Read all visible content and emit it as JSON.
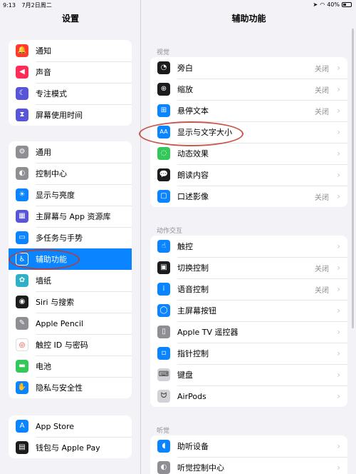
{
  "status": {
    "time": "9:13",
    "date": "7月2日周二",
    "battery": "40%"
  },
  "sidebar": {
    "title": "设置",
    "groups": [
      [
        {
          "label": "通知",
          "icon": "bell-icon"
        },
        {
          "label": "声音",
          "icon": "speaker-icon"
        },
        {
          "label": "专注模式",
          "icon": "moon-icon"
        },
        {
          "label": "屏幕使用时间",
          "icon": "hourglass-icon"
        }
      ],
      [
        {
          "label": "通用",
          "icon": "gear-icon"
        },
        {
          "label": "控制中心",
          "icon": "toggles-icon"
        },
        {
          "label": "显示与亮度",
          "icon": "sun-icon"
        },
        {
          "label": "主屏幕与 App 资源库",
          "icon": "grid-icon"
        },
        {
          "label": "多任务与手势",
          "icon": "multitask-icon"
        },
        {
          "label": "辅助功能",
          "icon": "accessibility-icon",
          "selected": true
        },
        {
          "label": "墙纸",
          "icon": "flower-icon"
        },
        {
          "label": "Siri 与搜索",
          "icon": "siri-icon"
        },
        {
          "label": "Apple Pencil",
          "icon": "pencil-icon"
        },
        {
          "label": "触控 ID 与密码",
          "icon": "fingerprint-icon"
        },
        {
          "label": "电池",
          "icon": "battery-icon"
        },
        {
          "label": "隐私与安全性",
          "icon": "hand-icon"
        }
      ],
      [
        {
          "label": "App Store",
          "icon": "appstore-icon"
        },
        {
          "label": "钱包与 Apple Pay",
          "icon": "wallet-icon"
        }
      ]
    ]
  },
  "detail": {
    "title": "辅助功能",
    "sections": [
      {
        "header": "视觉",
        "rows": [
          {
            "label": "旁白",
            "value": "关闭",
            "icon": "voiceover-icon"
          },
          {
            "label": "缩放",
            "value": "关闭",
            "icon": "zoom-icon"
          },
          {
            "label": "悬停文本",
            "value": "关闭",
            "icon": "hover-text-icon"
          },
          {
            "label": "显示与文字大小",
            "value": "",
            "icon": "text-size-icon"
          },
          {
            "label": "动态效果",
            "value": "",
            "icon": "motion-icon"
          },
          {
            "label": "朗读内容",
            "value": "",
            "icon": "speech-icon"
          },
          {
            "label": "口述影像",
            "value": "关闭",
            "icon": "audio-description-icon"
          }
        ]
      },
      {
        "header": "动作交互",
        "rows": [
          {
            "label": "触控",
            "value": "",
            "icon": "touch-icon"
          },
          {
            "label": "切换控制",
            "value": "关闭",
            "icon": "switch-control-icon"
          },
          {
            "label": "语音控制",
            "value": "关闭",
            "icon": "voice-control-icon"
          },
          {
            "label": "主屏幕按钮",
            "value": "",
            "icon": "home-button-icon"
          },
          {
            "label": "Apple TV 遥控器",
            "value": "",
            "icon": "remote-icon"
          },
          {
            "label": "指针控制",
            "value": "",
            "icon": "pointer-icon"
          },
          {
            "label": "键盘",
            "value": "",
            "icon": "keyboard-icon"
          },
          {
            "label": "AirPods",
            "value": "",
            "icon": "airpods-icon"
          }
        ]
      },
      {
        "header": "听觉",
        "rows": [
          {
            "label": "助听设备",
            "value": "",
            "icon": "ear-icon"
          },
          {
            "label": "听觉控制中心",
            "value": "",
            "icon": "hearing-control-icon"
          }
        ]
      }
    ]
  }
}
